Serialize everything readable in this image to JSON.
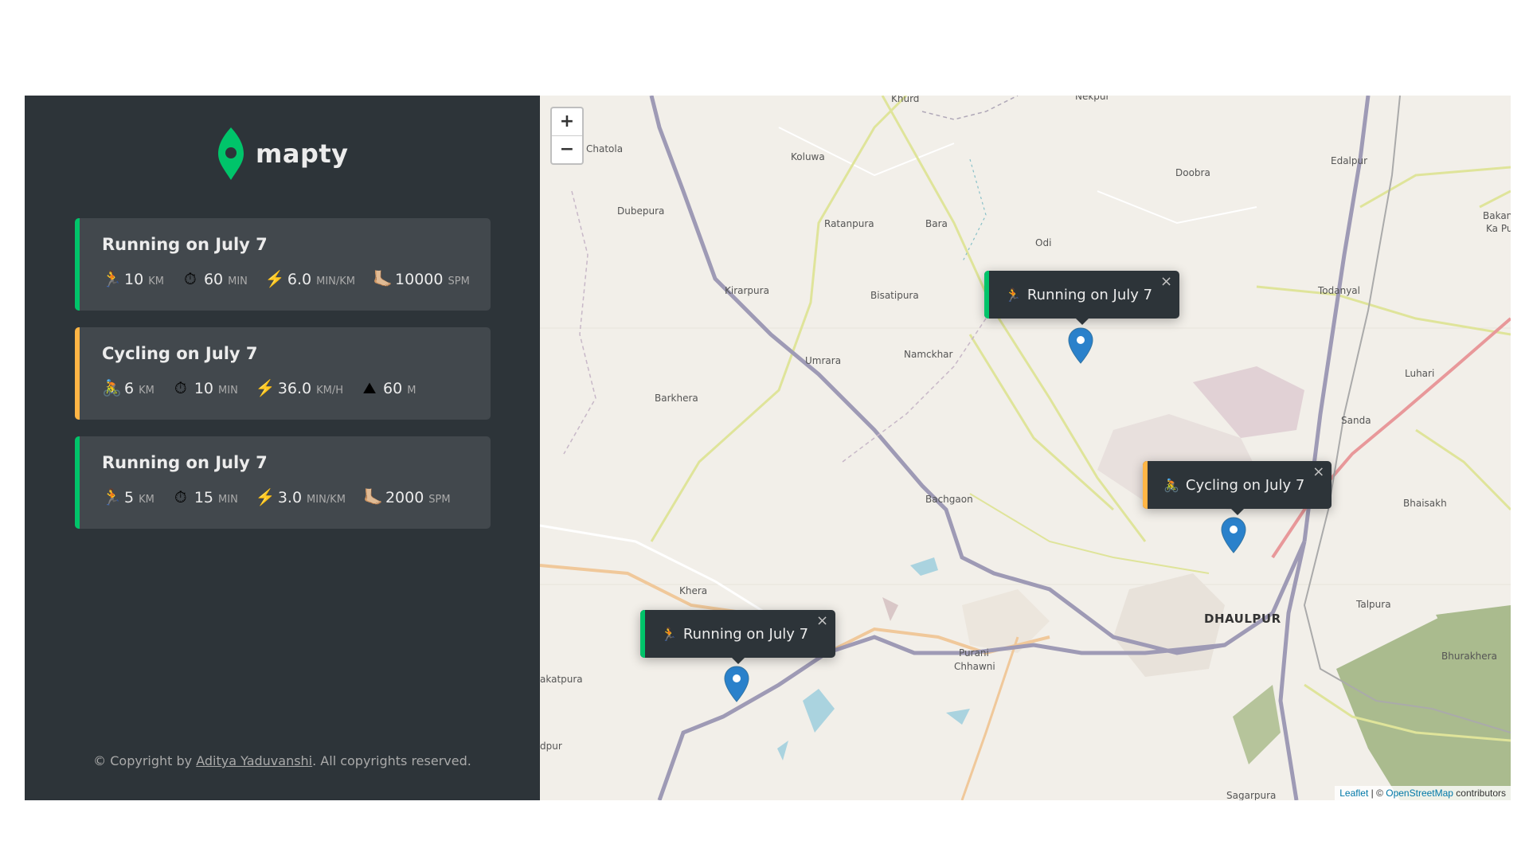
{
  "brand": {
    "name": "mapty",
    "accent": "#00c46a"
  },
  "colors": {
    "running": "#00c46a",
    "cycling": "#ffb545",
    "sidebar": "#2d3439",
    "card": "#42484d"
  },
  "workouts": [
    {
      "type": "running",
      "title": "Running on July 7",
      "d1": {
        "icon": "🏃",
        "value": "10",
        "unit": "km"
      },
      "d2": {
        "icon": "⏱",
        "value": "60",
        "unit": "min"
      },
      "d3": {
        "icon": "⚡️",
        "value": "6.0",
        "unit": "min/km"
      },
      "d4": {
        "icon": "🦶🏼",
        "value": "10000",
        "unit": "spm"
      }
    },
    {
      "type": "cycling",
      "title": "Cycling on July 7",
      "d1": {
        "icon": "🚴",
        "value": "6",
        "unit": "km"
      },
      "d2": {
        "icon": "⏱",
        "value": "10",
        "unit": "min"
      },
      "d3": {
        "icon": "⚡️",
        "value": "36.0",
        "unit": "km/h"
      },
      "d4": {
        "icon": "⛰",
        "value": "60",
        "unit": "m"
      }
    },
    {
      "type": "running",
      "title": "Running on July 7",
      "d1": {
        "icon": "🏃",
        "value": "5",
        "unit": "km"
      },
      "d2": {
        "icon": "⏱",
        "value": "15",
        "unit": "min"
      },
      "d3": {
        "icon": "⚡️",
        "value": "3.0",
        "unit": "min/km"
      },
      "d4": {
        "icon": "🦶🏼",
        "value": "2000",
        "unit": "spm"
      }
    }
  ],
  "copyright": {
    "prefix": "© Copyright by ",
    "author": "Aditya Yaduvanshi",
    "suffix": ". All copyrights reserved."
  },
  "map": {
    "zoom_in": "+",
    "zoom_out": "−",
    "popups": [
      {
        "type": "running",
        "icon": "🏃",
        "label": "Running on July 7",
        "close": "×"
      },
      {
        "type": "cycling",
        "icon": "🚴",
        "label": "Cycling on July 7",
        "close": "×"
      },
      {
        "type": "running",
        "icon": "🏃",
        "label": "Running on July 7",
        "close": "×"
      }
    ],
    "places": {
      "khurd": "Khurd",
      "nekpur": "Nekpur",
      "chatola": "Chatola",
      "koluwa": "Koluwa",
      "doobra": "Doobra",
      "edalpur": "Edalpur",
      "dubepura": "Dubepura",
      "ratanpura": "Ratanpura",
      "bara": "Bara",
      "odi": "Odi",
      "bakan": "Bakan",
      "kapu": "Ka Pu",
      "kirarpura": "Kirarpura",
      "bisatipura": "Bisatipura",
      "todanyal": "Todanyal",
      "umrara": "Umrara",
      "namckhar": "Namckhar",
      "luhari": "Luhari",
      "barkhera": "Barkhera",
      "sanda": "Sanda",
      "bachgaon": "Bachgaon",
      "bhaisakh": "Bhaisakh",
      "khera": "Khera",
      "dhaulpur": "DHAULPUR",
      "talpura": "Talpura",
      "purani": "Purani",
      "chhawni": "Chhawni",
      "bhurakhera": "Bhurakhera",
      "akatpura": "akatpura",
      "dpur": "dpur",
      "sagarpura": "Sagarpura"
    },
    "attribution": {
      "leaflet": "Leaflet",
      "sep": " | © ",
      "osm": "OpenStreetMap",
      "contrib": " contributors"
    }
  }
}
